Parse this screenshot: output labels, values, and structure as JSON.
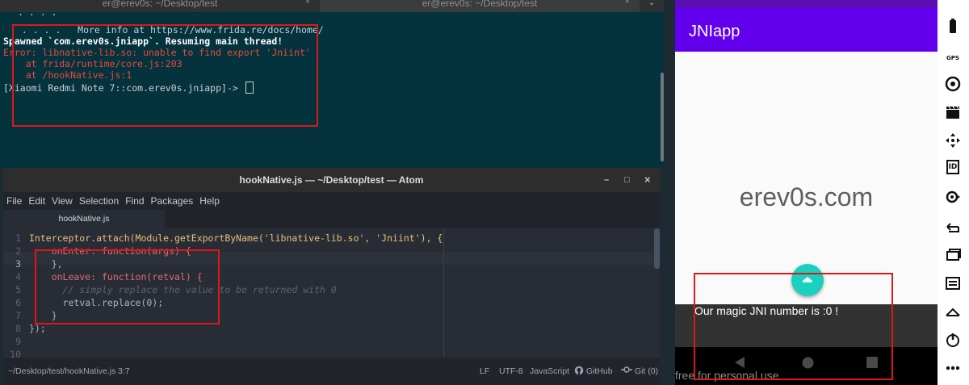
{
  "terminal": {
    "tabs": [
      {
        "title": "er@erev0s: ~/Desktop/test",
        "close": "×",
        "active": true
      },
      {
        "title": "er@erev0s: ~/Desktop/test",
        "close": "×",
        "active": false
      }
    ],
    "add_tab": "⌄",
    "lines": [
      ". . . .",
      " . . . .   More info at https://www.frida.re/docs/home/",
      "Spawned `com.erev0s.jniapp`. Resuming main thread!",
      "Error: libnative-lib.so: unable to find export 'Jniint'",
      "    at frida/runtime/core.js:203",
      "    at /hookNative.js:1",
      "[Xiaomi Redmi Note 7::com.erev0s.jniapp]-> "
    ]
  },
  "atom": {
    "window_title": "hookNative.js — ~/Desktop/test — Atom",
    "window_controls": {
      "minimize": "–",
      "maximize": "□",
      "close": "×"
    },
    "menu": [
      "File",
      "Edit",
      "View",
      "Selection",
      "Find",
      "Packages",
      "Help"
    ],
    "tab": "hookNative.js",
    "line_numbers": [
      "1",
      "2",
      "3",
      "4",
      "5",
      "6",
      "7",
      "8",
      "9",
      "10"
    ],
    "code": [
      "Interceptor.attach(Module.getExportByName('libnative-lib.so', 'Jniint'), {",
      "    onEnter: function(args) {",
      "    },",
      "    onLeave: function(retval) {",
      "      // simply replace the value to be returned with 0",
      "      retval.replace(0);",
      "    }",
      "});",
      "",
      ""
    ],
    "status": {
      "path": "~/Desktop/test/hookNative.js",
      "cursor": "3:7",
      "eol": "LF",
      "encoding": "UTF-8",
      "grammar": "JavaScript",
      "github": "GitHub",
      "git": "Git (0)"
    }
  },
  "phone": {
    "app_title": "JNIapp",
    "domain_text": "erev0s.com",
    "snackbar": "Our magic JNI number is :0 !",
    "watermark": "free for personal use"
  },
  "emulator_toolbar": {
    "icons": [
      "battery-icon",
      "gps-icon",
      "camera-icon",
      "clapper-icon",
      "dpad-icon",
      "id-icon",
      "fingerprint-icon",
      "rotate-icon",
      "window-icon",
      "menu-icon",
      "home-icon",
      "power-icon",
      "more-icon"
    ],
    "labels": {
      "gps": "GPS",
      "id": "ID"
    }
  },
  "colors": {
    "terminal_bg": "#04323d",
    "error_red": "#e84a3a",
    "atom_bg": "#282c34",
    "app_purple": "#6200ee",
    "fab_teal": "#1ad0bf",
    "highlight_box": "#e0161a"
  }
}
